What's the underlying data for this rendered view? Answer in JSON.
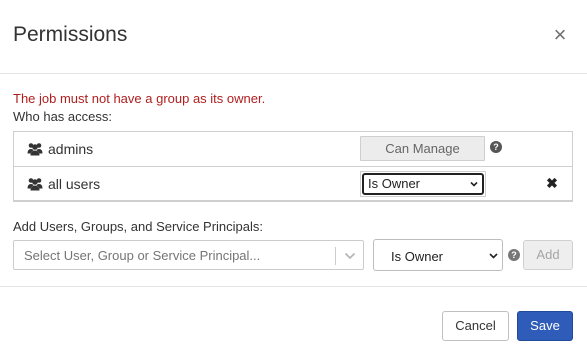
{
  "dialog": {
    "title": "Permissions",
    "close_icon": "close-icon"
  },
  "body": {
    "error": "The job must not have a group as its owner.",
    "who_has_access_label": "Who has access:",
    "access_rows": [
      {
        "icon": "group-icon",
        "name": "admins",
        "permission": "Can Manage",
        "help_icon": "question-circle-icon"
      },
      {
        "icon": "group-icon",
        "name": "all users",
        "permission": "Is Owner",
        "remove_icon": "times-icon"
      }
    ],
    "add_label": "Add Users, Groups, and Service Principals:",
    "principal_placeholder": "Select User, Group or Service Principal...",
    "permission_select_value": "Is Owner",
    "add_button": "Add"
  },
  "footer": {
    "cancel": "Cancel",
    "save": "Save"
  },
  "colors": {
    "error": "#b01f1f",
    "primary": "#2f5cb8"
  }
}
